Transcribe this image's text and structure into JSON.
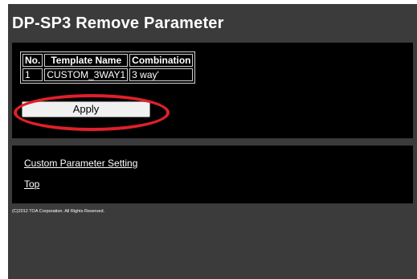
{
  "page": {
    "title": "DP-SP3 Remove Parameter",
    "background_color": "#3b3b3b",
    "panel_color": "#000000",
    "highlight_color": "#e0202a"
  },
  "params_table": {
    "headers": [
      "No.",
      "Template Name",
      "Combination"
    ],
    "rows": [
      [
        "1",
        "CUSTOM_3WAY1",
        "3 way'"
      ]
    ]
  },
  "apply_button": {
    "label": "Apply"
  },
  "links": {
    "custom_parameter_setting": "Custom Parameter Setting",
    "top": "Top"
  },
  "footer": {
    "copyright": "(C)2012 TOA Corporation. All Rights Reserved."
  }
}
